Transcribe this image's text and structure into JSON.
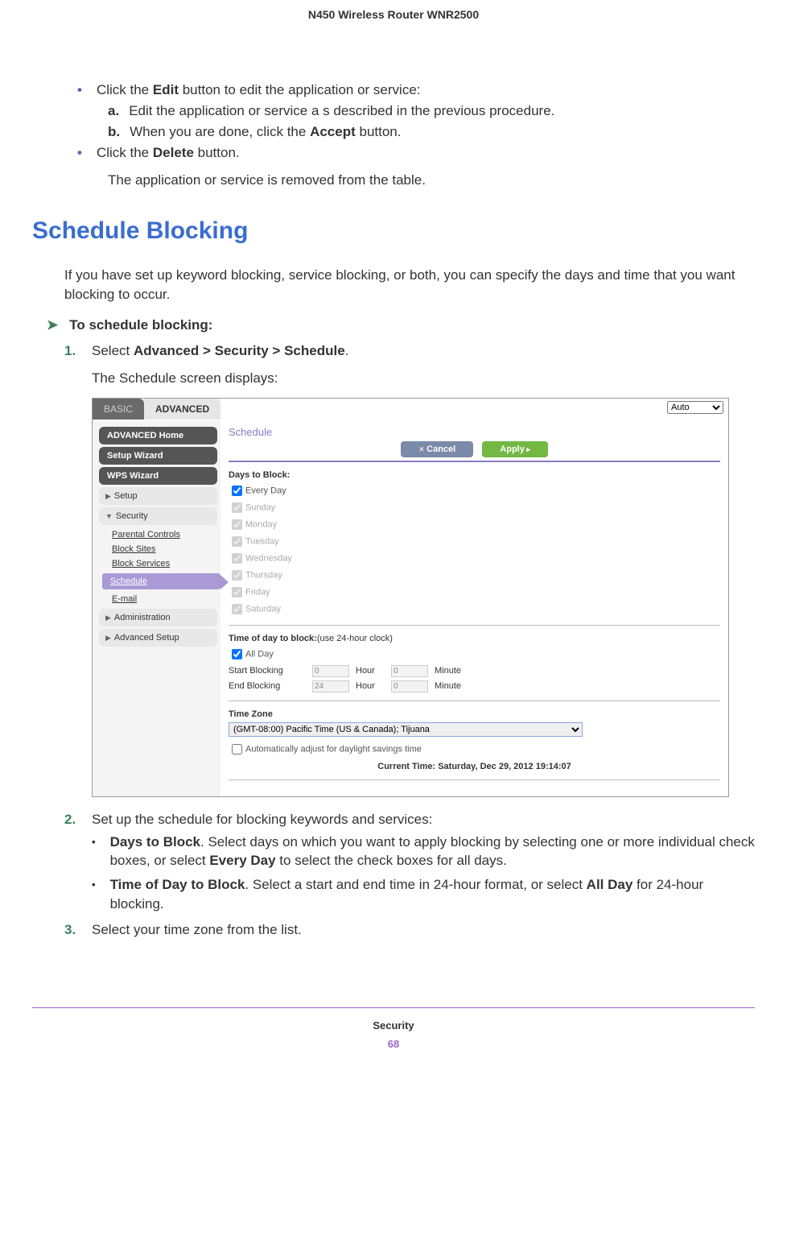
{
  "header": {
    "title": "N450 Wireless Router WNR2500"
  },
  "top_bullets": {
    "edit_intro": [
      "Click the ",
      "Edit",
      " button to edit the application or service:"
    ],
    "step_a": {
      "label": "a.",
      "text": "Edit the  application or service a s  described in the previous procedure."
    },
    "step_b": {
      "label": "b.",
      "text_pre": "When you are done, click the  ",
      "text_bold": "Accept",
      "text_post": " button."
    },
    "delete_line": [
      "Click the ",
      "Delete",
      " button."
    ],
    "delete_result": "The application or service is removed from the table."
  },
  "section_head": "Schedule Blocking",
  "intro": "If you have set up keyword blocking, service blocking, or both, you can specify the days and time that you want blocking to occur.",
  "proc_head": "To schedule blocking:",
  "step1": {
    "num": "1.",
    "text_pre": "Select ",
    "text_bold": "Advanced > Security > Schedule",
    "text_post": ".",
    "caption": "The Schedule screen displays:"
  },
  "screenshot": {
    "tabs": {
      "basic": "BASIC",
      "advanced": "ADVANCED"
    },
    "auto_label": "Auto",
    "sidebar": {
      "home": "ADVANCED Home",
      "setup_wizard": "Setup Wizard",
      "wps_wizard": "WPS Wizard",
      "setup": "Setup",
      "security": "Security",
      "sec_items": {
        "parental": "Parental Controls",
        "sites": "Block Sites",
        "services": "Block Services",
        "schedule": "Schedule",
        "email": "E-mail"
      },
      "admin": "Administration",
      "adv_setup": "Advanced Setup"
    },
    "content": {
      "title": "Schedule",
      "cancel": "Cancel",
      "apply": "Apply",
      "days_title": "Days to Block:",
      "days": [
        "Every Day",
        "Sunday",
        "Monday",
        "Tuesday",
        "Wednesday",
        "Thursday",
        "Friday",
        "Saturday"
      ],
      "time_title_pre": "Time of day to block:",
      "time_title_hint": "(use 24-hour clock)",
      "all_day": "All Day",
      "start": "Start Blocking",
      "end": "End Blocking",
      "start_h": "0",
      "start_m": "0",
      "end_h": "24",
      "end_m": "0",
      "hour": "Hour",
      "minute": "Minute",
      "tz_title": "Time Zone",
      "tz_value": "(GMT-08:00) Pacific Time (US & Canada); Tijuana",
      "dst": "Automatically adjust for daylight savings time",
      "current": "Current Time: Saturday, Dec 29, 2012 19:14:07"
    }
  },
  "step2": {
    "num": "2.",
    "text": "Set up the schedule for blocking keywords and services:",
    "b1_bold": "Days to Block",
    "b1_text1": ". Select days on which you want to apply blocking by selecting one or more individual check boxes, or select ",
    "b1_bold2": "Every Day",
    "b1_text2": " to select the check boxes for all days.",
    "b2_bold": "Time of Day to Block",
    "b2_text1": ". Select a start and end time in 24-hour format, or select ",
    "b2_bold2": "All Day",
    "b2_text2": " for 24-hour blocking."
  },
  "step3": {
    "num": "3.",
    "text": "Select your time zone from the list."
  },
  "footer": {
    "section": "Security",
    "page": "68"
  }
}
